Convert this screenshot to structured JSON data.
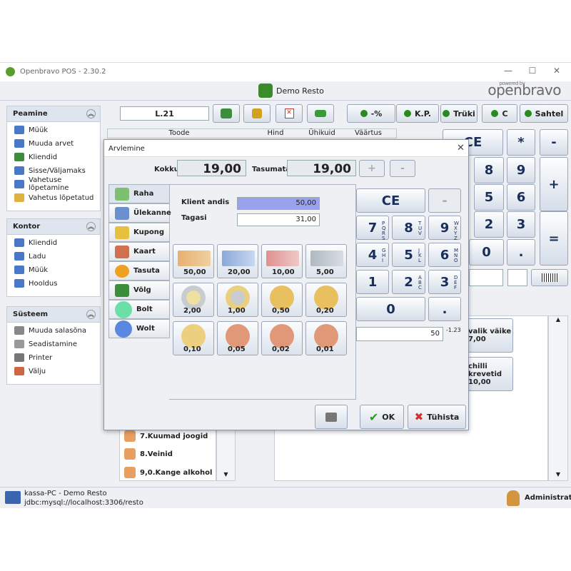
{
  "window": {
    "title": "Openbravo POS - 2.30.2",
    "minimize": "—",
    "maximize": "☐",
    "close": "✕"
  },
  "header": {
    "app_name": "Demo Resto",
    "brand": "openbravo",
    "brand_tag": "powered by"
  },
  "left": {
    "peamine": {
      "title": "Peamine",
      "items": [
        "Müük",
        "Muuda arvet",
        "Kliendid",
        "Sisse/Väljamaks",
        "Vahetuse lõpetamine",
        "Vahetus lõpetatud"
      ]
    },
    "kontor": {
      "title": "Kontor",
      "items": [
        "Kliendid",
        "Ladu",
        "Müük",
        "Hooldus"
      ]
    },
    "susteem": {
      "title": "Süsteem",
      "items": [
        "Muuda salasõna",
        "Seadistamine",
        "Printer",
        "Välju"
      ]
    }
  },
  "toolbar": {
    "ticket": "L.21",
    "btn_discount": "-%",
    "btn_kp": "K.P.",
    "btn_print": "Trüki",
    "btn_c": "C",
    "btn_drawer": "Sahtel"
  },
  "table": {
    "headers": [
      "Toode",
      "Hind",
      "Ühikuid",
      "Väärtus"
    ]
  },
  "bg_keys": {
    "ce": "CE",
    "star": "*",
    "minus": "-",
    "plus": "+",
    "eq": "=",
    "k8": "8",
    "k9": "9",
    "k5": "5",
    "k6": "6",
    "k2": "2",
    "k3": "3",
    "k0": "0",
    "dot": "."
  },
  "categories": [
    "7.Kuumad joogid",
    "8.Veinid",
    "9,0.Kange alkohol"
  ],
  "products": [
    {
      "name": "valik väike",
      "price": "7,00"
    },
    {
      "name": "chilli krevetid",
      "price": "10,00"
    }
  ],
  "status": {
    "host": "kassa-PC - Demo Resto",
    "db": "jdbc:mysql://localhost:3306/resto",
    "user": "Administrator"
  },
  "dialog": {
    "title": "Arvlemine",
    "total_label": "Kokku",
    "total_value": "19,00",
    "unpaid_label": "Tasumata",
    "unpaid_value": "19,00",
    "plus": "+",
    "minus": "-",
    "tabs": [
      "Raha",
      "Ülekanne",
      "Kupong",
      "Kaart",
      "Tasuta",
      "Võlg",
      "Bolt",
      "Wolt"
    ],
    "given_label": "Klient andis",
    "given_value": "50,00",
    "change_label": "Tagasi",
    "change_value": "31,00",
    "notes": [
      "50,00",
      "20,00",
      "10,00",
      "5,00"
    ],
    "coins": [
      "2,00",
      "1,00",
      "0,50",
      "0,20",
      "0,10",
      "0,05",
      "0,02",
      "0,01"
    ],
    "keypad": {
      "ce": "CE",
      "minus": "-",
      "k7": "7",
      "k8": "8",
      "k9": "9",
      "k4": "4",
      "k5": "5",
      "k6": "6",
      "k1": "1",
      "k2": "2",
      "k3": "3",
      "k0": "0",
      "dot": ".",
      "s7": "P Q R S",
      "s8": "T U V",
      "s9": "W X Y Z",
      "s4": "G H I",
      "s5": "J K L",
      "s6": "M N O",
      "s2": "A B C",
      "s3": "D E F"
    },
    "input_value": "50",
    "input_diff": "-1.23",
    "ok": "OK",
    "cancel": "Tühista"
  }
}
